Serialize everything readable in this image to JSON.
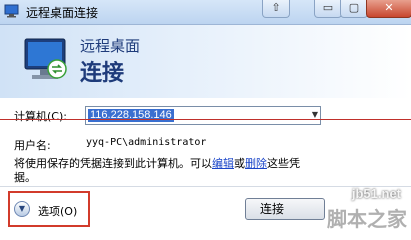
{
  "window": {
    "title": "远程桌面连接"
  },
  "titlebar_controls": {
    "up": "⇧",
    "minimize": "▭",
    "maximize": "▢",
    "close": "✕"
  },
  "header": {
    "subtitle": "远程桌面",
    "title": "连接"
  },
  "form": {
    "computer_label": "计算机(C):",
    "computer_value": "116.228.158.146",
    "username_label": "用户名:",
    "username_value": "yyq-PC\\administrator"
  },
  "note": {
    "text_before": "将使用保存的凭据连接到此计算机。可以",
    "edit_link": "编辑",
    "or": "或",
    "delete_link": "删除",
    "text_after": "这些凭据。"
  },
  "footer": {
    "options_label": "选项(O)",
    "connect_label": "连接"
  },
  "watermark": {
    "url": "jb51.net",
    "text": "脚本之家"
  },
  "colors": {
    "accent_red": "#d23b2b",
    "header_blue": "#1e3b7a",
    "link": "#1a45c8"
  }
}
